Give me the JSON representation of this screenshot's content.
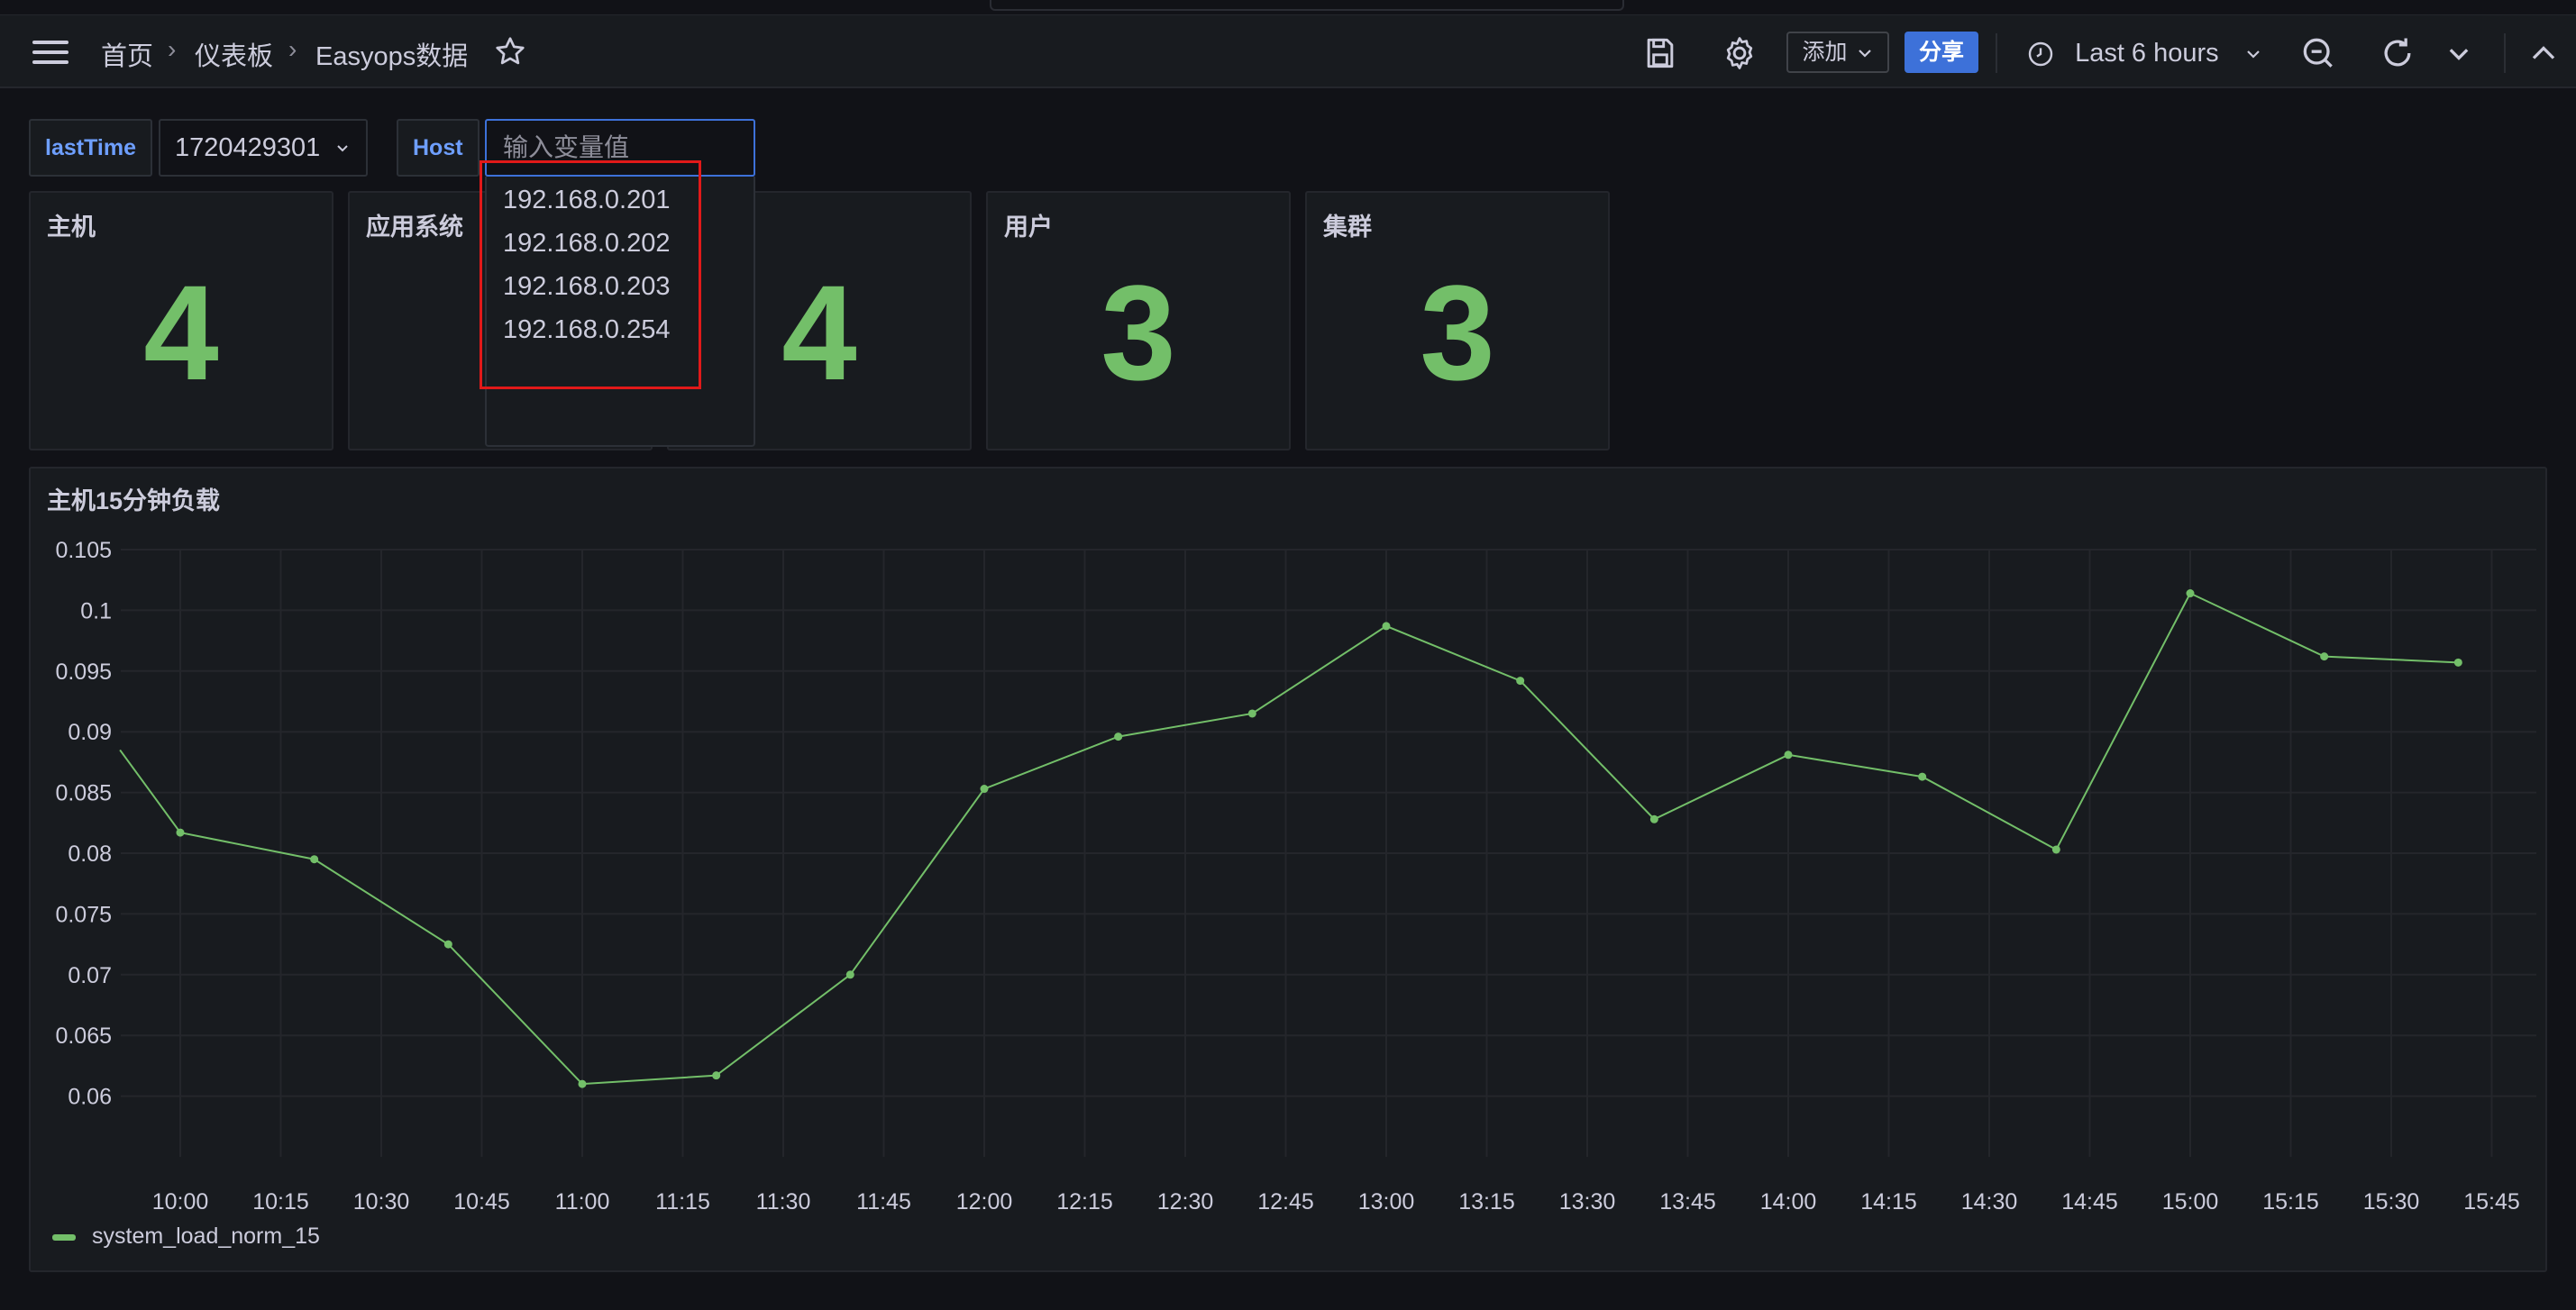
{
  "breadcrumb": {
    "home": "首页",
    "dashboards": "仪表板",
    "current": "Easyops数据"
  },
  "toolbar": {
    "add_label": "添加",
    "share_label": "分享",
    "time_range": "Last 6 hours"
  },
  "variables": {
    "lastTime": {
      "label": "lastTime",
      "value": "1720429301"
    },
    "host": {
      "label": "Host",
      "placeholder": "输入变量值",
      "options": [
        "192.168.0.201",
        "192.168.0.202",
        "192.168.0.203",
        "192.168.0.254"
      ]
    }
  },
  "stats": [
    {
      "title": "主机",
      "value": "4"
    },
    {
      "title": "应用系统",
      "value": ""
    },
    {
      "title": "",
      "value": "4"
    },
    {
      "title": "用户",
      "value": "3"
    },
    {
      "title": "集群",
      "value": "3"
    }
  ],
  "colors": {
    "accent": "#3d71d9",
    "series": "#73bf69",
    "highlight": "#e11919",
    "background": "#111217",
    "panel": "#181b1f"
  },
  "icons": [
    "menu-icon",
    "star-icon",
    "save-icon",
    "gear-icon",
    "chevron-down-icon",
    "clock-icon",
    "zoom-out-icon",
    "refresh-icon"
  ],
  "chart_data": {
    "type": "line",
    "title": "主机15分钟负载",
    "xlabel": "",
    "ylabel": "",
    "ylim": [
      0.055,
      0.105
    ],
    "y_ticks": [
      "0.105",
      "0.1",
      "0.095",
      "0.09",
      "0.085",
      "0.08",
      "0.075",
      "0.07",
      "0.065",
      "0.06"
    ],
    "x_ticks": [
      "10:00",
      "10:15",
      "10:30",
      "10:45",
      "11:00",
      "11:15",
      "11:30",
      "11:45",
      "12:00",
      "12:15",
      "12:30",
      "12:45",
      "13:00",
      "13:15",
      "13:30",
      "13:45",
      "14:00",
      "14:15",
      "14:30",
      "14:45",
      "15:00",
      "15:15",
      "15:30",
      "15:45"
    ],
    "grid": true,
    "legend": "bottom-left",
    "series": [
      {
        "name": "system_load_norm_15",
        "points": [
          [
            "09:51",
            0.0885
          ],
          [
            "10:00",
            0.0817
          ],
          [
            "10:20",
            0.0795
          ],
          [
            "10:40",
            0.0725
          ],
          [
            "11:00",
            0.061
          ],
          [
            "11:20",
            0.0617
          ],
          [
            "11:40",
            0.07
          ],
          [
            "12:00",
            0.0853
          ],
          [
            "12:20",
            0.0896
          ],
          [
            "12:40",
            0.0915
          ],
          [
            "13:00",
            0.0987
          ],
          [
            "13:20",
            0.0942
          ],
          [
            "13:40",
            0.0828
          ],
          [
            "14:00",
            0.0881
          ],
          [
            "14:20",
            0.0863
          ],
          [
            "14:40",
            0.0803
          ],
          [
            "15:00",
            0.1014
          ],
          [
            "15:20",
            0.0962
          ],
          [
            "15:40",
            0.0957
          ]
        ]
      }
    ]
  }
}
